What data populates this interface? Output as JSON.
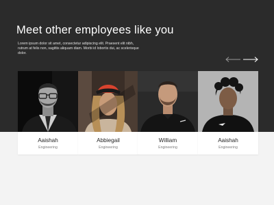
{
  "header": {
    "title": "Meet other employees like you",
    "description": "Lorem ipsum dolor sit amet, consectetur adipiscing elit. Praesent elit nibh, rutrum at felis non, sagittis aliquam diam. Morbi id lobortis dui, ac scelerisque dolor."
  },
  "nav": {
    "prev_icon": "arrow-left-icon",
    "next_icon": "arrow-right-icon"
  },
  "employees": [
    {
      "name": "Aaishah",
      "role": "Engineering"
    },
    {
      "name": "Abbiegail",
      "role": "Engineering"
    },
    {
      "name": "William",
      "role": "Engineering"
    },
    {
      "name": "Aaishah",
      "role": "Engineering"
    }
  ],
  "colors": {
    "hero_background": "#2b2b2b",
    "page_background": "#f3f3f3",
    "card_background": "#ffffff"
  }
}
